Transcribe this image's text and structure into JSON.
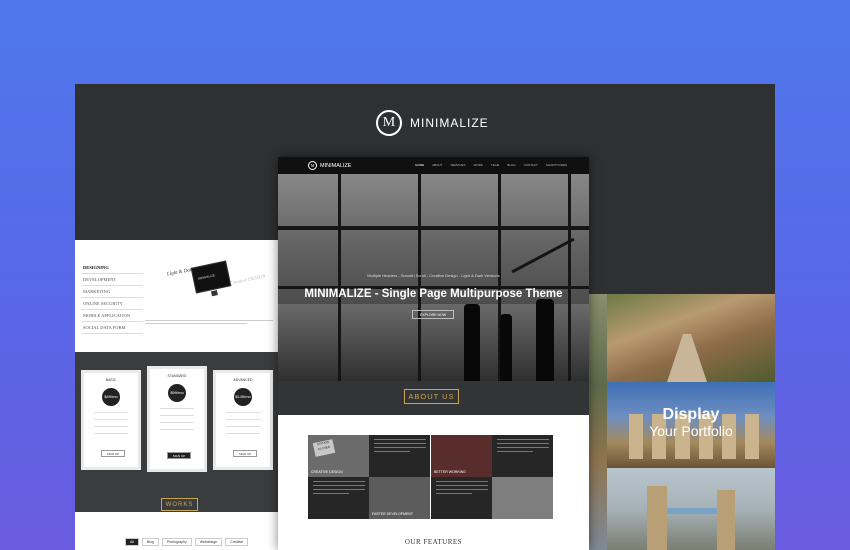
{
  "brand": {
    "logo_letter": "M",
    "name": "MINIMALIZE"
  },
  "left_page": {
    "menu": [
      "DESIGNING",
      "DEVELOPMENT",
      "MARKETING",
      "ONLINE SECURITY",
      "MOBILE APPLICATION",
      "SOCIAL DATA FORM"
    ],
    "monitor_text": "MINIMALIZE",
    "tagline1": "Light & Dark",
    "tagline2": "Creative DESIGN",
    "pricing": [
      {
        "name": "BASIC",
        "price": "$49/mo",
        "button": "SIGN UP"
      },
      {
        "name": "STANDARD",
        "price": "$99/mo",
        "button": "SIGN UP"
      },
      {
        "name": "ADVANCED",
        "price": "$149/mo",
        "button": "SIGN UP"
      }
    ],
    "works_label": "WORKS",
    "filters": [
      "All",
      "Blog",
      "Photography",
      "Webdesign",
      "Creative"
    ]
  },
  "center_page": {
    "nav_logo_letter": "M",
    "nav_name": "MINIMALIZE",
    "nav_links": [
      "HOME",
      "ABOUT",
      "SERVICES",
      "WORK",
      "TEAM",
      "BLOG",
      "CONTACT",
      "SHORTCODES"
    ],
    "hero_tagline": "Multiple Headers - Smooth Scroll - Creative Design - Light & Dark Versions",
    "hero_title": "MINIMALIZE - Single Page Multipurpose Theme",
    "explore_label": "EXPLORE NOW",
    "about_label": "ABOUT US",
    "tiles": [
      {
        "label": "CREATIVE DESIGN",
        "sign": "STATION CLOSED"
      },
      {
        "label": "",
        "sign": ""
      },
      {
        "label": "BETTER WORKING",
        "sign": ""
      },
      {
        "label": "",
        "sign": ""
      },
      {
        "label": "",
        "sign": ""
      },
      {
        "label": "FASTER DEVELOPMENT",
        "sign": ""
      },
      {
        "label": "",
        "sign": ""
      },
      {
        "label": "",
        "sign": ""
      }
    ],
    "features_label": "OUR FEATURES"
  },
  "right_page": {
    "display_line1": "Display",
    "display_line2": "Your Portfolio"
  },
  "colors": {
    "accent_gold": "#c8a552",
    "background_dark": "#2f3032",
    "bg_gradient_top": "#4f78ec",
    "bg_gradient_bottom": "#6a5be0"
  }
}
